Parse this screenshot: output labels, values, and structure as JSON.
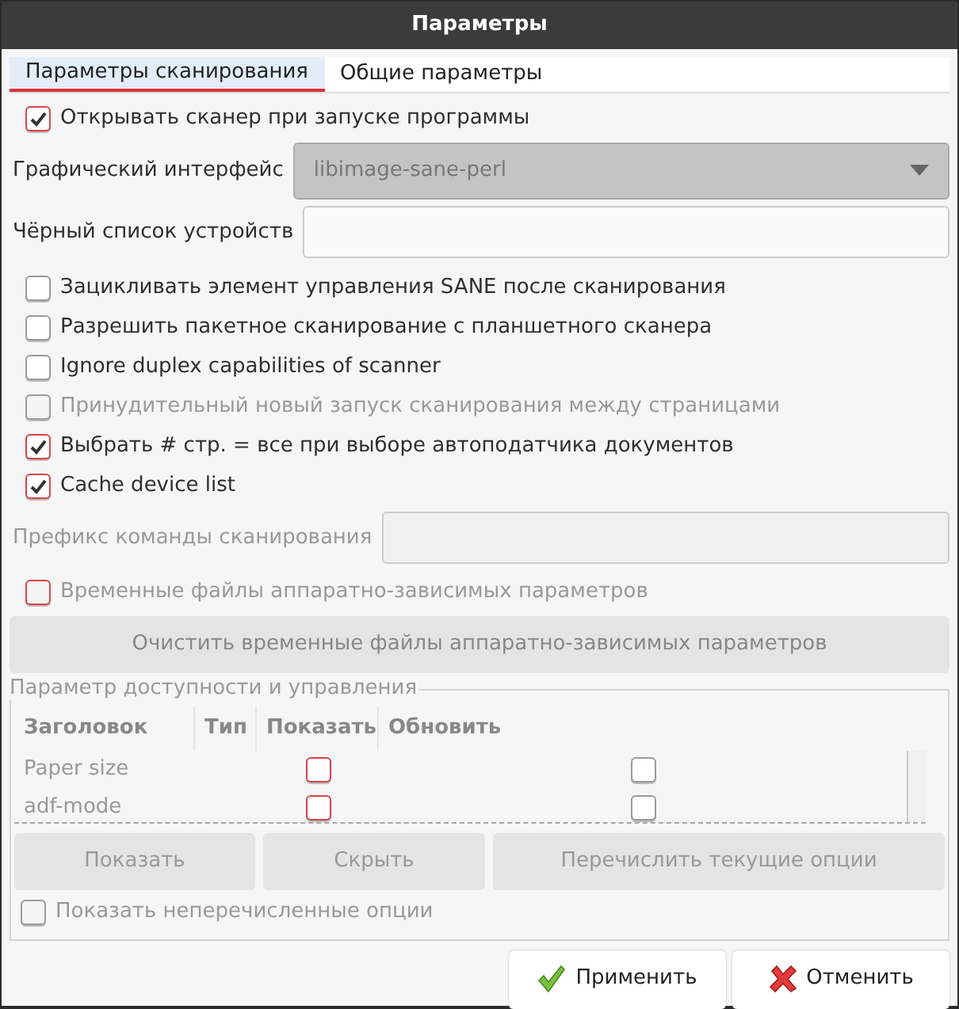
{
  "window": {
    "title": "Параметры"
  },
  "tabs": [
    {
      "label": "Параметры сканирования",
      "selected": true
    },
    {
      "label": "Общие параметры",
      "selected": false
    }
  ],
  "open_scanner": {
    "label": "Открывать сканер при запуске программы",
    "checked": true,
    "color": "#d9434b",
    "disabled": false
  },
  "frontend": {
    "label": "Графический интерфейс",
    "value": "libimage-sane-perl",
    "disabled": true
  },
  "blacklist": {
    "label": "Чёрный список устройств",
    "disabled": false
  },
  "options": [
    {
      "label": "Зацикливать элемент управления SANE после сканирования",
      "checked": false,
      "color": "#9a9a9a",
      "disabled": false
    },
    {
      "label": "Разрешить пакетное сканирование с планшетного сканера",
      "checked": false,
      "color": "#9a9a9a",
      "disabled": false
    },
    {
      "label": "Ignore duplex capabilities of scanner",
      "checked": false,
      "color": "#9a9a9a",
      "disabled": false
    },
    {
      "label": "Принудительный новый запуск сканирования между страницами",
      "checked": false,
      "color": "#9a9a9a",
      "disabled": true
    },
    {
      "label": "Выбрать # стр. = все при выборе автоподатчика документов",
      "checked": true,
      "color": "#d9434b",
      "disabled": false
    },
    {
      "label": "Cache device list",
      "checked": true,
      "color": "#d9434b",
      "disabled": false
    }
  ],
  "prefix": {
    "label": "Префикс команды сканирования",
    "disabled": true
  },
  "temp_files": {
    "label": "Временные файлы аппаратно-зависимых параметров",
    "checked": false,
    "color": "#d9434b",
    "disabled": true
  },
  "clear_button": {
    "label": "Очистить временные файлы аппаратно-зависимых параметров",
    "disabled": true
  },
  "group": {
    "title": "Параметр доступности и управления",
    "table": {
      "columns": [
        "Заголовок",
        "Тип",
        "Показать",
        "Обновить"
      ],
      "rows": [
        {
          "title": "Paper size",
          "show": false,
          "color": "#d9434b",
          "reload": false
        },
        {
          "title": "adf-mode",
          "show": false,
          "color": "#d9434b",
          "reload": false
        }
      ]
    },
    "buttons": [
      {
        "label": "Показать",
        "disabled": true
      },
      {
        "label": "Скрыть",
        "disabled": true
      },
      {
        "label": "Перечислить текущие опции",
        "disabled": true
      }
    ],
    "show_unlisted": {
      "label": "Показать неперечисленные опции",
      "checked": false,
      "color": "#9a9a9a",
      "disabled": true
    }
  },
  "footer_buttons": [
    {
      "kind": "apply",
      "label": "Применить"
    },
    {
      "kind": "cancel",
      "label": "Отменить"
    }
  ]
}
